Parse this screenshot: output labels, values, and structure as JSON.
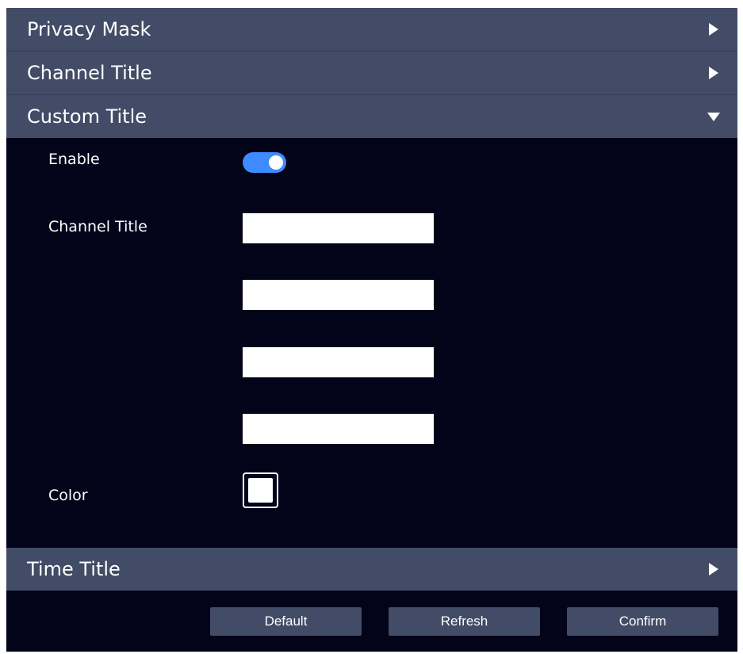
{
  "sections": {
    "privacy_mask": {
      "title": "Privacy Mask",
      "expanded": false
    },
    "channel_title": {
      "title": "Channel Title",
      "expanded": false
    },
    "custom_title": {
      "title": "Custom Title",
      "expanded": true
    },
    "time_title": {
      "title": "Time Title",
      "expanded": false
    }
  },
  "custom_title_form": {
    "enable_label": "Enable",
    "enable_value": true,
    "channel_title_label": "Channel Title",
    "channel_title_lines": [
      "",
      "",
      "",
      ""
    ],
    "color_label": "Color",
    "color_value": "#ffffff"
  },
  "buttons": {
    "default_label": "Default",
    "refresh_label": "Refresh",
    "confirm_label": "Confirm"
  },
  "theme": {
    "panel_bg": "#03031a",
    "header_bg": "#424c66",
    "toggle_on": "#3d8bff",
    "text": "#ffffff"
  },
  "icons": {
    "collapsed": "triangle-right-icon",
    "expanded": "triangle-down-icon"
  }
}
